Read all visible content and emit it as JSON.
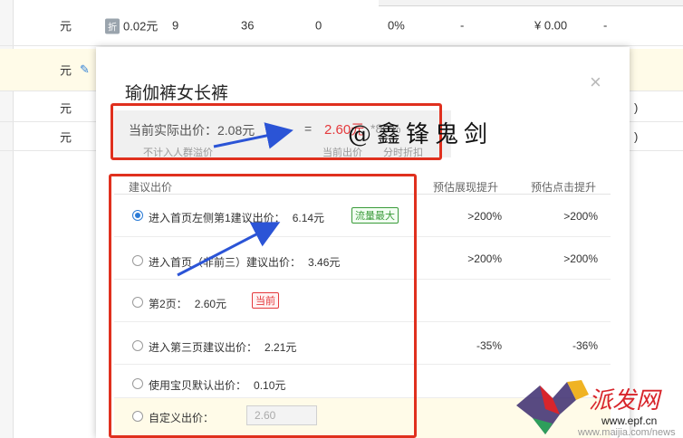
{
  "background": {
    "rows": [
      {
        "col1": "元",
        "tag": "折",
        "col2": "0.02元",
        "col3": "9",
        "col4": "36",
        "col5": "0",
        "col6": "0%",
        "col7": "-",
        "col8": "¥ 0.00",
        "col9": "-"
      },
      {
        "col1": "元"
      },
      {
        "col1": "元",
        "col10": ")"
      },
      {
        "col1": "元",
        "col10": ")"
      }
    ]
  },
  "modal": {
    "title": "瑜伽裤女长裤",
    "close_symbol": "×",
    "price_panel": {
      "actual_label": "当前实际出价：",
      "actual_value": "2.08元",
      "equals": "=",
      "current_value": "2.60元",
      "multiplier": "*80%",
      "sub_excluded": "不计入人群溢价",
      "sub_current": "当前出价",
      "sub_discount": "分时折扣"
    },
    "watermark": "@鑫锋鬼剑",
    "headers": {
      "suggest": "建议出价",
      "impression": "预估展现提升",
      "click": "预估点击提升"
    },
    "options": [
      {
        "label": "进入首页左侧第1建议出价：",
        "price": "6.14元",
        "badge": "流量最大",
        "impression": ">200%",
        "click": ">200%",
        "checked": true
      },
      {
        "label": "进入首页（非前三）建议出价：",
        "price": "3.46元",
        "badge": "",
        "impression": ">200%",
        "click": ">200%",
        "checked": false
      },
      {
        "label": "第2页：",
        "price": "2.60元",
        "badge": "当前",
        "impression": "",
        "click": "",
        "checked": false
      },
      {
        "label": "进入第三页建议出价：",
        "price": "2.21元",
        "badge": "",
        "impression": "-35%",
        "click": "-36%",
        "checked": false
      },
      {
        "label": "使用宝贝默认出价：",
        "price": "0.10元",
        "badge": "",
        "impression": "",
        "click": "",
        "checked": false
      },
      {
        "label": "自定义出价：",
        "input_value": "2.60",
        "checked": false
      }
    ]
  },
  "site_logo": {
    "name": "派发网",
    "url1": "www.epf.cn",
    "url2": "www.maijia.com/news"
  },
  "colors": {
    "accent_blue": "#2b7bd6",
    "annotation_red": "#e0301e",
    "price_red": "#e4393c",
    "badge_green": "#3a9a3a"
  }
}
